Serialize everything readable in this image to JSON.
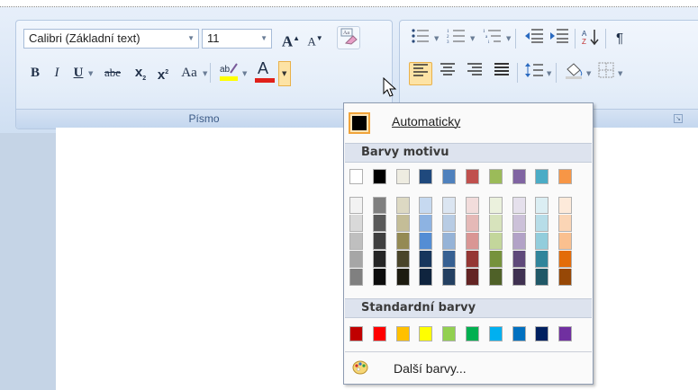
{
  "font_group": {
    "font_name": "Calibri (Základní text)",
    "font_size": "11",
    "label": "Písmo",
    "grow_font_label": "A",
    "shrink_font_label": "A",
    "bold_label": "B",
    "italic_label": "I",
    "underline_label": "U",
    "strike_label": "abe",
    "subscript_label": "x",
    "superscript_label": "x",
    "case_label": "Aa",
    "font_color_label": "A"
  },
  "dropdown": {
    "automatic_label": "Automaticky",
    "theme_header": "Barvy motivu",
    "standard_header": "Standardní barvy",
    "more_colors_label": "Další barvy...",
    "theme_top_row": [
      "#ffffff",
      "#000000",
      "#eeece1",
      "#1f497d",
      "#4f81bd",
      "#c0504d",
      "#9bbb59",
      "#8064a2",
      "#4bacc6",
      "#f79646"
    ],
    "theme_shades": [
      [
        "#f2f2f2",
        "#d9d9d9",
        "#bfbfbf",
        "#a6a6a6",
        "#808080"
      ],
      [
        "#7f7f7f",
        "#595959",
        "#404040",
        "#262626",
        "#0d0d0d"
      ],
      [
        "#ddd9c3",
        "#c4bd97",
        "#948a54",
        "#4a452a",
        "#1d1b10"
      ],
      [
        "#c6d9f0",
        "#8db3e2",
        "#548dd4",
        "#17365d",
        "#0f243e"
      ],
      [
        "#dbe5f1",
        "#b8cce4",
        "#95b3d7",
        "#366092",
        "#244061"
      ],
      [
        "#f2dcdb",
        "#e5b9b7",
        "#d99694",
        "#953734",
        "#632423"
      ],
      [
        "#ebf1dd",
        "#d7e3bc",
        "#c3d69b",
        "#76923c",
        "#4f6128"
      ],
      [
        "#e5e0ec",
        "#ccc1d9",
        "#b2a2c7",
        "#5f497a",
        "#3f3151"
      ],
      [
        "#dbeef3",
        "#b7dde8",
        "#92cddc",
        "#31859b",
        "#205867"
      ],
      [
        "#fdeada",
        "#fbd5b5",
        "#fac08f",
        "#e36c09",
        "#974806"
      ]
    ],
    "standard_colors": [
      "#c00000",
      "#ff0000",
      "#ffc000",
      "#ffff00",
      "#92d050",
      "#00b050",
      "#00b0f0",
      "#0070c0",
      "#002060",
      "#7030a0"
    ]
  },
  "colors": {
    "font_color_bar": "#e0201a",
    "highlight_bar": "#ffff00"
  }
}
